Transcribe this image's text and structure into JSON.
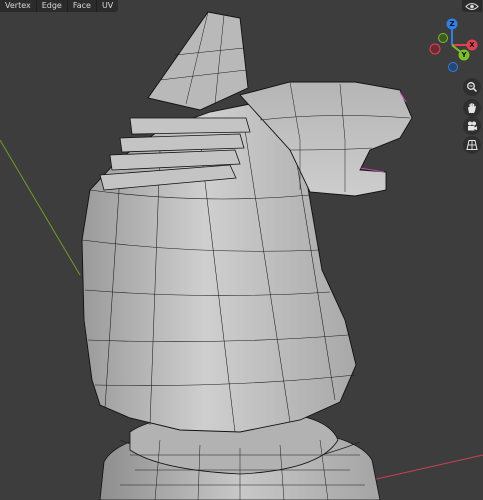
{
  "header": {
    "menu": [
      {
        "label": "Vertex"
      },
      {
        "label": "Edge"
      },
      {
        "label": "Face"
      },
      {
        "label": "UV"
      }
    ]
  },
  "gizmo": {
    "axes": [
      {
        "label": "Z",
        "color": "#2f7fe6"
      },
      {
        "label": "X",
        "color": "#e0434f"
      },
      {
        "label": "Y",
        "color": "#7bbf2a"
      }
    ]
  },
  "tools": [
    {
      "name": "zoom-icon"
    },
    {
      "name": "hand-icon"
    },
    {
      "name": "camera-icon"
    },
    {
      "name": "grid-icon"
    }
  ],
  "colors": {
    "background": "#3d3d3d",
    "mesh": "#bdbdbd",
    "wire": "#111111",
    "x_axis_line": "#c9434f",
    "y_axis_line": "#6e9b2c"
  }
}
